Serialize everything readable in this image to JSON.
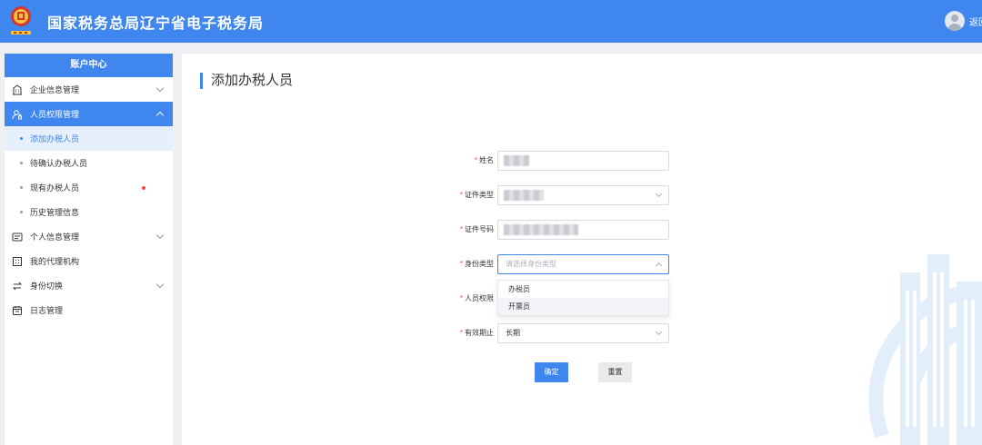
{
  "header": {
    "title": "国家税务总局辽宁省电子税务局",
    "user_name": "返回",
    "emblem": "tax-emblem-icon",
    "colors": {
      "primary": "#3f86ef",
      "accent_red": "#f04a3a"
    }
  },
  "sidebar": {
    "title": "账户中心",
    "items": [
      {
        "label": "企业信息管理",
        "icon": "building-icon"
      },
      {
        "label": "人员权限管理",
        "icon": "user-lock-icon"
      },
      {
        "label": "个人信息管理",
        "icon": "id-card-icon"
      },
      {
        "label": "我的代理机构",
        "icon": "agency-icon"
      },
      {
        "label": "身份切换",
        "icon": "switch-icon"
      },
      {
        "label": "日志管理",
        "icon": "log-icon"
      }
    ],
    "subitems": [
      {
        "label": "添加办税人员"
      },
      {
        "label": "待确认办税人员"
      },
      {
        "label": "现有办税人员"
      },
      {
        "label": "历史管理信息"
      }
    ]
  },
  "main": {
    "page_title": "添加办税人员",
    "form": {
      "name_label": "姓名",
      "id_type_label": "证件类型",
      "id_number_label": "证件号码",
      "identity_type_label": "身份类型",
      "identity_type_placeholder": "请选择身份类型",
      "permission_label": "人员权限",
      "expiry_label": "有效期止",
      "expiry_value": "长期"
    },
    "dropdown_options": [
      "办税员",
      "开票员"
    ],
    "buttons": {
      "confirm": "确定",
      "reset": "重置"
    }
  }
}
